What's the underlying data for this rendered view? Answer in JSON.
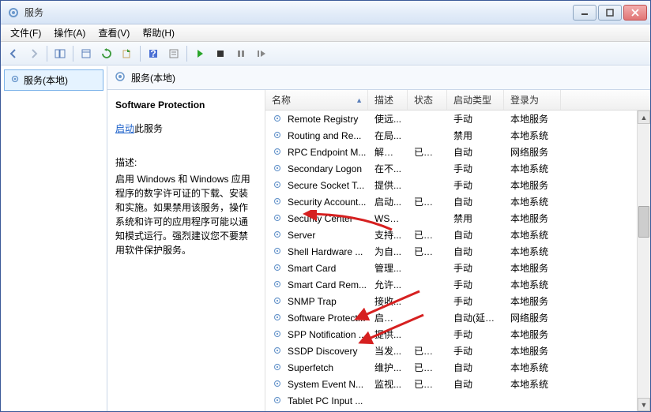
{
  "window": {
    "title": "服务"
  },
  "menu": {
    "file": "文件(F)",
    "action": "操作(A)",
    "view": "查看(V)",
    "help": "帮助(H)"
  },
  "tree": {
    "root": "服务(本地)"
  },
  "right_header": "服务(本地)",
  "detail": {
    "title": "Software Protection",
    "start_link": "启动",
    "start_suffix": "此服务",
    "desc_label": "描述:",
    "desc": "启用 Windows 和 Windows 应用程序的数字许可证的下载、安装和实施。如果禁用该服务，操作系统和许可的应用程序可能以通知模式运行。强烈建议您不要禁用软件保护服务。"
  },
  "columns": {
    "name": "名称",
    "desc": "描述",
    "status": "状态",
    "startup": "启动类型",
    "logon": "登录为"
  },
  "col_w": {
    "name": 130,
    "desc": 50,
    "status": 50,
    "startup": 72,
    "logon": 72
  },
  "services": [
    {
      "name": "Remote Registry",
      "desc": "使远...",
      "status": "",
      "startup": "手动",
      "logon": "本地服务"
    },
    {
      "name": "Routing and Re...",
      "desc": "在局...",
      "status": "",
      "startup": "禁用",
      "logon": "本地系统"
    },
    {
      "name": "RPC Endpoint M...",
      "desc": "解析 ...",
      "status": "已启动",
      "startup": "自动",
      "logon": "网络服务"
    },
    {
      "name": "Secondary Logon",
      "desc": "在不...",
      "status": "",
      "startup": "手动",
      "logon": "本地系统"
    },
    {
      "name": "Secure Socket T...",
      "desc": "提供...",
      "status": "",
      "startup": "手动",
      "logon": "本地服务"
    },
    {
      "name": "Security Account...",
      "desc": "启动...",
      "status": "已启动",
      "startup": "自动",
      "logon": "本地系统"
    },
    {
      "name": "Security Center",
      "desc": "WSC...",
      "status": "",
      "startup": "禁用",
      "logon": "本地服务"
    },
    {
      "name": "Server",
      "desc": "支持...",
      "status": "已启动",
      "startup": "自动",
      "logon": "本地系统"
    },
    {
      "name": "Shell Hardware ...",
      "desc": "为自...",
      "status": "已启动",
      "startup": "自动",
      "logon": "本地系统"
    },
    {
      "name": "Smart Card",
      "desc": "管理...",
      "status": "",
      "startup": "手动",
      "logon": "本地服务"
    },
    {
      "name": "Smart Card Rem...",
      "desc": "允许...",
      "status": "",
      "startup": "手动",
      "logon": "本地系统"
    },
    {
      "name": "SNMP Trap",
      "desc": "接收...",
      "status": "",
      "startup": "手动",
      "logon": "本地服务"
    },
    {
      "name": "Software Protect...",
      "desc": "启用 ...",
      "status": "",
      "startup": "自动(延迟...",
      "logon": "网络服务"
    },
    {
      "name": "SPP Notification ...",
      "desc": "提供...",
      "status": "",
      "startup": "手动",
      "logon": "本地服务"
    },
    {
      "name": "SSDP Discovery",
      "desc": "当发...",
      "status": "已启动",
      "startup": "手动",
      "logon": "本地服务"
    },
    {
      "name": "Superfetch",
      "desc": "维护...",
      "status": "已启动",
      "startup": "自动",
      "logon": "本地系统"
    },
    {
      "name": "System Event N...",
      "desc": "监视...",
      "status": "已启动",
      "startup": "自动",
      "logon": "本地系统"
    },
    {
      "name": "Tablet PC Input ...",
      "desc": "",
      "status": "",
      "startup": "",
      "logon": ""
    }
  ]
}
